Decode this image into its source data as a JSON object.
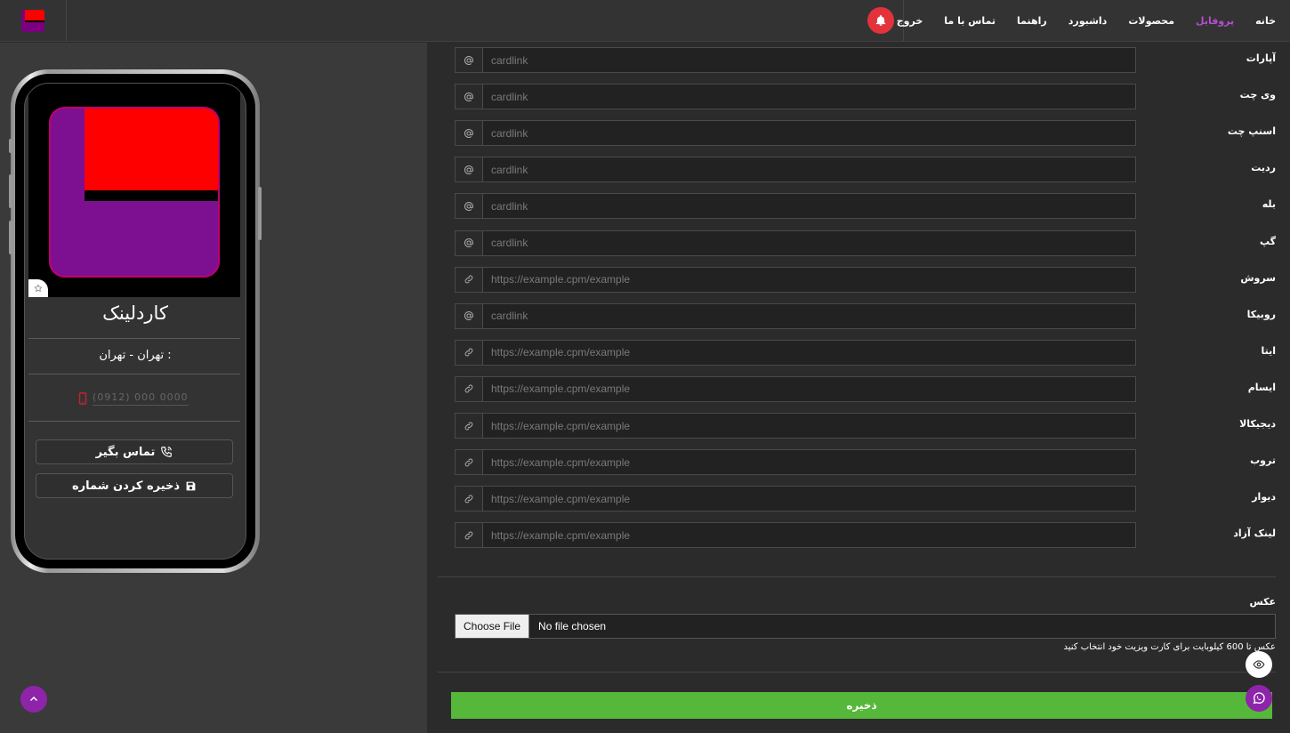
{
  "nav": {
    "links": [
      {
        "label": "خانه",
        "active": false
      },
      {
        "label": "پروفایل",
        "active": true
      },
      {
        "label": "محصولات",
        "active": false
      },
      {
        "label": "داشبورد",
        "active": false
      },
      {
        "label": "راهنما",
        "active": false
      },
      {
        "label": "تماس با ما",
        "active": false
      },
      {
        "label": "خروج",
        "active": false
      }
    ],
    "accent": "#b54dcf",
    "bell_color": "#e3323b"
  },
  "preview": {
    "name": "کاردلینک",
    "location": "تهران - تهران :",
    "phone_placeholder": "(0912) 000 0000",
    "call_button": "تماس بگیر",
    "save_contact_button": "ذخیره کردن شماره"
  },
  "fields": [
    {
      "label": "آپارات",
      "icon": "at-icon",
      "placeholder": "cardlink"
    },
    {
      "label": "وی چت",
      "icon": "at-icon",
      "placeholder": "cardlink"
    },
    {
      "label": "اسنپ چت",
      "icon": "at-icon",
      "placeholder": "cardlink"
    },
    {
      "label": "ردیت",
      "icon": "at-icon",
      "placeholder": "cardlink"
    },
    {
      "label": "بله",
      "icon": "at-icon",
      "placeholder": "cardlink"
    },
    {
      "label": "گپ",
      "icon": "at-icon",
      "placeholder": "cardlink"
    },
    {
      "label": "سروش",
      "icon": "link-icon",
      "placeholder": "https://example.cpm/example"
    },
    {
      "label": "روبیکا",
      "icon": "at-icon",
      "placeholder": "cardlink"
    },
    {
      "label": "ایتا",
      "icon": "link-icon",
      "placeholder": "https://example.cpm/example"
    },
    {
      "label": "ایسام",
      "icon": "link-icon",
      "placeholder": "https://example.cpm/example"
    },
    {
      "label": "دیجیکالا",
      "icon": "link-icon",
      "placeholder": "https://example.cpm/example"
    },
    {
      "label": "تروب",
      "icon": "link-icon",
      "placeholder": "https://example.cpm/example"
    },
    {
      "label": "دیوار",
      "icon": "link-icon",
      "placeholder": "https://example.cpm/example"
    },
    {
      "label": "لینک آزاد",
      "icon": "link-icon",
      "placeholder": "https://example.cpm/example"
    }
  ],
  "photo": {
    "label": "عکس",
    "choose_button": "Choose File",
    "status": "No file chosen",
    "help": "عکس تا 600 کیلوبایت برای کارت ویزیت خود انتخاب کنید"
  },
  "save_button": "ذخیره",
  "colors": {
    "save_green": "#55b83a",
    "fab_purple": "#8e24aa",
    "logo_red": "#ff0000",
    "logo_purple": "#7d1090"
  }
}
